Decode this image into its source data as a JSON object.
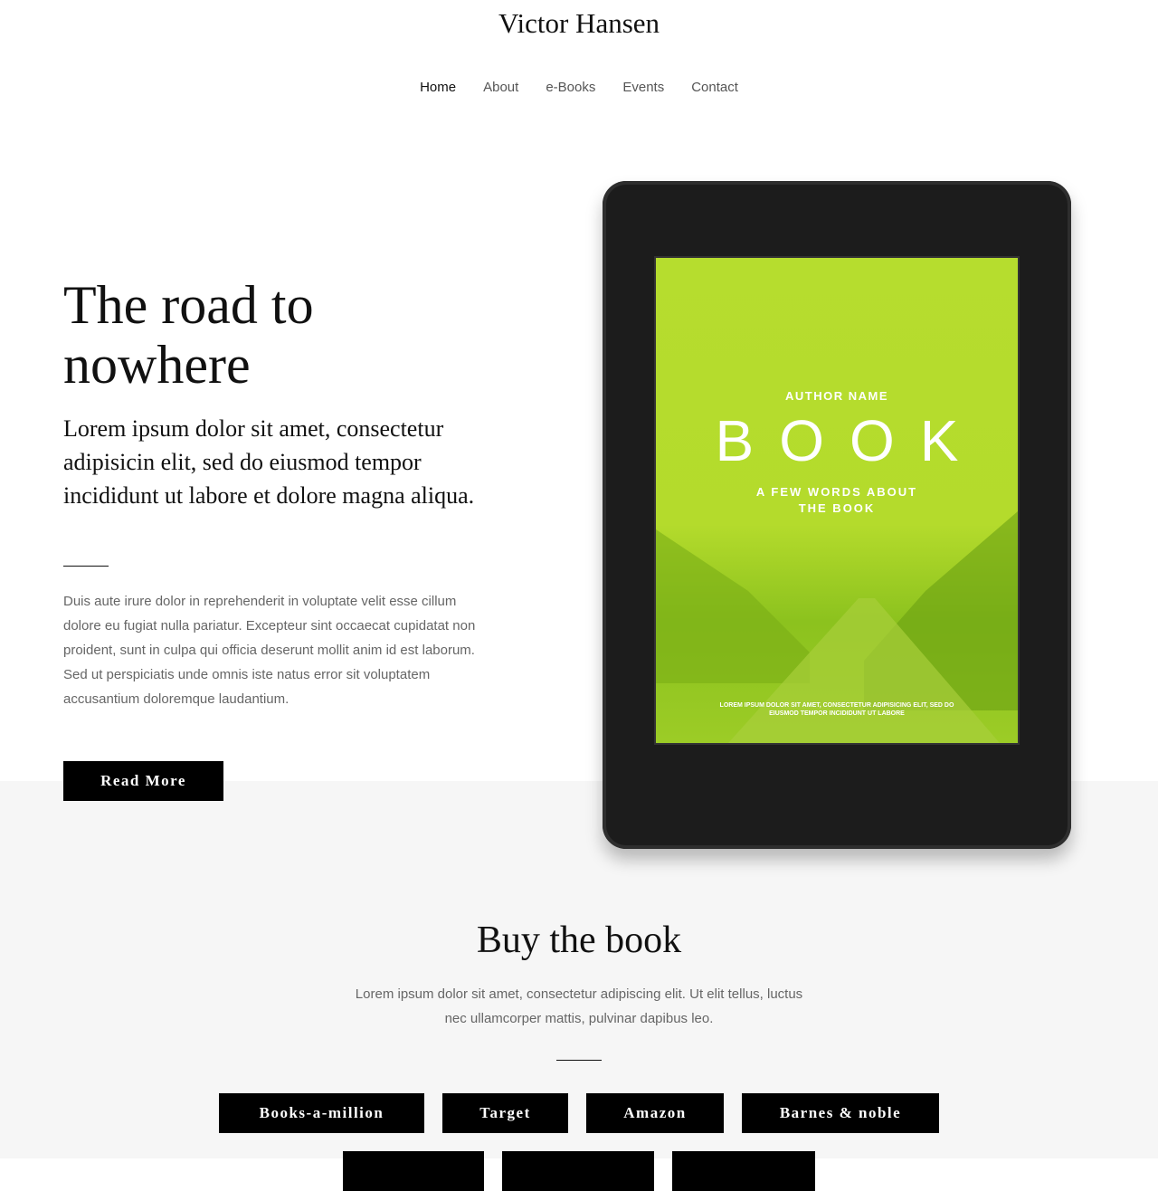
{
  "site": {
    "title": "Victor Hansen"
  },
  "nav": [
    {
      "label": "Home",
      "active": true
    },
    {
      "label": "About"
    },
    {
      "label": "e-Books"
    },
    {
      "label": "Events"
    },
    {
      "label": "Contact"
    }
  ],
  "hero": {
    "title": "The road to nowhere",
    "lead": "Lorem ipsum dolor sit amet, consectetur adipisicin elit, sed do eiusmod tempor incididunt ut labore et dolore magna aliqua.",
    "body": "Duis aute irure dolor in reprehenderit in voluptate velit esse cillum dolore eu fugiat nulla pariatur. Excepteur sint occaecat cupidatat non proident, sunt in culpa qui officia deserunt mollit anim id est laborum. Sed ut perspiciatis unde omnis iste natus error sit voluptatem accusantium doloremque laudantium.",
    "button": "Read More"
  },
  "cover": {
    "author": "AUTHOR NAME",
    "title": "BOOK",
    "tagline": "A FEW WORDS ABOUT THE BOOK",
    "blurb": "LOREM IPSUM DOLOR SIT AMET, CONSECTETUR ADIPISICING ELIT, SED DO EIUSMOD TEMPOR INCIDIDUNT UT LABORE",
    "color": "#b6dd2e"
  },
  "buy": {
    "title": "Buy the book",
    "text": "Lorem ipsum dolor sit amet, consectetur adipiscing elit. Ut elit tellus, luctus nec ullamcorper mattis, pulvinar dapibus leo.",
    "stores": [
      "Books-a-million",
      "Target",
      "Amazon",
      "Barnes & noble"
    ]
  }
}
